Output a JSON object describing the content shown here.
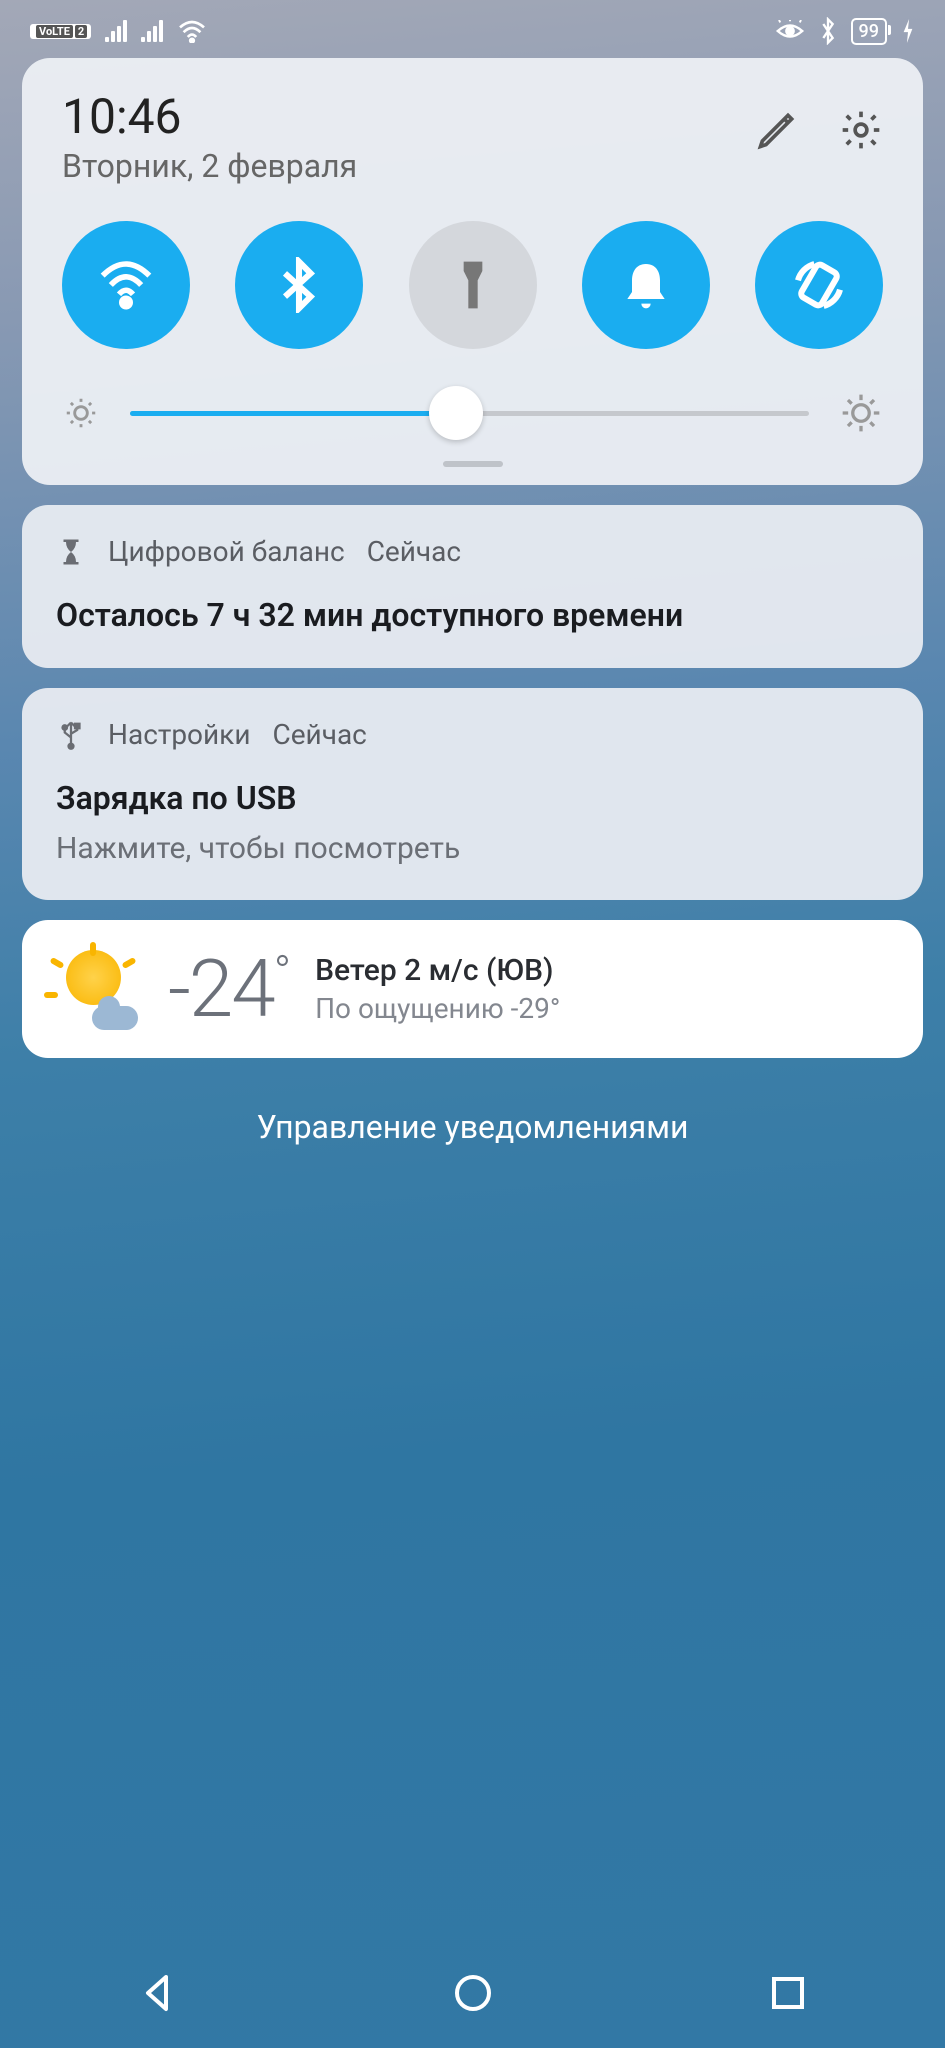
{
  "status": {
    "volte": "VoLTE",
    "volte_sim": "2",
    "battery": "99"
  },
  "quick_settings": {
    "time": "10:46",
    "date": "Вторник, 2 февраля",
    "brightness_percent": 48
  },
  "notifications": [
    {
      "icon": "hourglass",
      "app": "Цифровой баланс",
      "when": "Сейчас",
      "title": "Осталось 7 ч 32 мин доступного времени",
      "subtitle": ""
    },
    {
      "icon": "usb",
      "app": "Настройки",
      "when": "Сейчас",
      "title": "Зарядка по USB",
      "subtitle": "Нажмите, чтобы посмотреть"
    }
  ],
  "weather": {
    "temp": "-24",
    "wind_line": "Ветер 2 м/с (ЮВ)",
    "feels_line": "По ощущению -29°"
  },
  "manage_label": "Управление уведомлениями"
}
